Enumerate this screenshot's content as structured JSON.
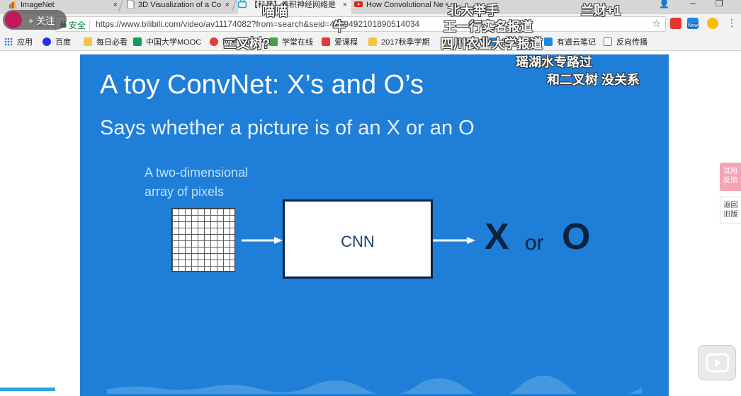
{
  "tabs": [
    {
      "title": "ImageNet",
      "close": "×"
    },
    {
      "title": "3D Visualization of a Co",
      "close": "×"
    },
    {
      "title": "【科普】卷积神经网络是",
      "close": "×"
    },
    {
      "title": "How Convolutional Ne",
      "close": "×"
    }
  ],
  "window": {
    "user": "👤",
    "minimize": "–",
    "restore": "❐"
  },
  "address": {
    "secure_label": "安全",
    "url": "https://www.bilibili.com/video/av11174082?from=search&seid=4739492101890514034",
    "star": "☆"
  },
  "extensions": [
    {
      "name": "ext-red",
      "color": "#e5362b"
    },
    {
      "name": "ext-new",
      "color": "#1e88e5",
      "label": "New"
    },
    {
      "name": "ext-flower",
      "color": "#fbbc05"
    }
  ],
  "bookmarks": [
    {
      "label": "应用",
      "icon": "apps-icon",
      "color": "#3a7bd5"
    },
    {
      "label": "百度",
      "icon": "baidu-icon",
      "color": "#2932e1"
    },
    {
      "label": "每日必看",
      "icon": "folder-icon",
      "color": "#f4c542"
    },
    {
      "label": "中国大学MOOC",
      "icon": "mooc-icon",
      "color": "#0f9d58"
    },
    {
      "label": "网易云课堂",
      "icon": "netease-icon",
      "color": "#e53935"
    },
    {
      "label": "学堂在线",
      "icon": "xuetang-icon",
      "color": "#43a047"
    },
    {
      "label": "爱课程",
      "icon": "icourse-icon",
      "color": "#e53935"
    },
    {
      "label": "2017秋季学期",
      "icon": "folder-icon",
      "color": "#f4c542"
    },
    {
      "label": "网站导航",
      "icon": "folder-icon",
      "color": "#f4c542"
    },
    {
      "label": "网页云笔记",
      "icon": "note-icon",
      "color": "#1e88e5"
    },
    {
      "label": "有道云笔记",
      "icon": "youdao-icon",
      "color": "#1e88e5"
    },
    {
      "label": "反向传播",
      "icon": "page-icon",
      "color": "#ffffff"
    }
  ],
  "slide": {
    "title": "A toy ConvNet: X’s and O’s",
    "subtitle": "Says whether a picture is of an X or an O",
    "note_line1": "A two-dimensional",
    "note_line2": "array of pixels",
    "cnn_label": "CNN",
    "output_x": "X",
    "output_or": "or",
    "output_o": "O"
  },
  "danmaku": [
    "喵喵",
    "北大举手",
    "兰财+1",
    "王一行实名报道",
    "牛",
    "二叉树?",
    "四川农业大学报道",
    "瑶湖水专路过",
    "和二叉树  没关系"
  ],
  "follow": {
    "label": "+ 关注"
  },
  "side": {
    "feedback": "试用反馈",
    "feedback_line1": "试用",
    "feedback_line2": "反馈",
    "old_line1": "返回",
    "old_line2": "旧版"
  },
  "colors": {
    "slide_bg": "#1f7fd8",
    "dark_navy": "#0c2340",
    "secure_green": "#0b8043"
  }
}
